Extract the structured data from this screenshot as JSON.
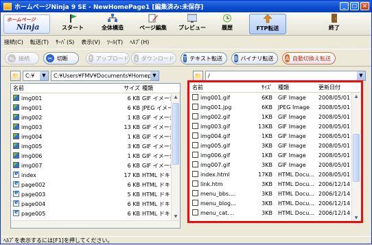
{
  "window": {
    "title": "ホームページNinja 9 SE - NewHomePage1 [編集済み:未保存]",
    "controls": [
      "_",
      "□",
      "×"
    ]
  },
  "toolbar": {
    "logo_top": "ホームページ",
    "logo_main": "Ninja",
    "tools": [
      {
        "label": "スタート",
        "icon": "start-flag-icon",
        "color": "#2ba34a"
      },
      {
        "label": "全体構造",
        "icon": "structure-icon",
        "color": "#3a68c8"
      },
      {
        "label": "ページ編集",
        "icon": "page-edit-icon",
        "color": "#d03a2a"
      },
      {
        "label": "プレビュー",
        "icon": "preview-icon",
        "color": "#555555"
      },
      {
        "label": "履歴",
        "icon": "history-icon",
        "color": "#6cb33a"
      },
      {
        "label": "FTP転送",
        "icon": "ftp-transfer-icon",
        "color": "#e08a1a"
      },
      {
        "label": "終了",
        "icon": "exit-door-icon",
        "color": "#8a5a2a"
      }
    ]
  },
  "menu": [
    "接続(C)",
    "転送(T)",
    "ｻｰﾊﾞ(S)",
    "表示(V)",
    "ﾂｰﾙ(T)",
    "ﾍﾙﾌﾟ(H)"
  ],
  "actions": {
    "connect": "接続",
    "disconnect": "切断",
    "upload": "アップロード",
    "download": "ダウンロード",
    "text_transfer": "テキスト転送",
    "binary_transfer": "バイナリ転送",
    "auto_transfer": "自動切換え転送"
  },
  "local": {
    "drive": "C:¥",
    "path": "C:¥Users¥FMV¥Documents¥Homepage Ninja¥w",
    "columns": [
      "名前",
      "サイズ",
      "種類"
    ],
    "files": [
      {
        "name": "img001",
        "size": "6 KB",
        "type": "GIF イメージ",
        "icon": "image"
      },
      {
        "name": "img001",
        "size": "6 KB",
        "type": "JPEG イメージ",
        "icon": "image"
      },
      {
        "name": "img002",
        "size": "1 KB",
        "type": "GIF イメージ",
        "icon": "image"
      },
      {
        "name": "img003",
        "size": "13 KB",
        "type": "GIF イメージ",
        "icon": "image"
      },
      {
        "name": "img004",
        "size": "1 KB",
        "type": "GIF イメージ",
        "icon": "image"
      },
      {
        "name": "img005",
        "size": "3 KB",
        "type": "GIF イメージ",
        "icon": "image"
      },
      {
        "name": "img006",
        "size": "1 KB",
        "type": "GIF イメージ",
        "icon": "image"
      },
      {
        "name": "img007",
        "size": "6 KB",
        "type": "GIF イメージ",
        "icon": "image"
      },
      {
        "name": "index",
        "size": "17 KB",
        "type": "HTML ドキュ",
        "icon": "html"
      },
      {
        "name": "page002",
        "size": "6 KB",
        "type": "HTML ドキュ",
        "icon": "html"
      },
      {
        "name": "page003",
        "size": "5 KB",
        "type": "HTML ドキュ",
        "icon": "html"
      },
      {
        "name": "page004",
        "size": "6 KB",
        "type": "HTML ドキュ",
        "icon": "html"
      },
      {
        "name": "page005",
        "size": "6 KB",
        "type": "HTML ドキュ",
        "icon": "html"
      }
    ]
  },
  "remote": {
    "path": "/",
    "columns": [
      "名前",
      "ｻｲｽﾞ",
      "種類",
      "更新日付"
    ],
    "files": [
      {
        "name": "img001.gif",
        "size": "6KB",
        "type": "GIF Image",
        "date": "2008/05/01"
      },
      {
        "name": "img001.jpg",
        "size": "6KB",
        "type": "JPEG Image",
        "date": "2008/05/01"
      },
      {
        "name": "img002.gif",
        "size": "1KB",
        "type": "GIF Image",
        "date": "2008/05/01"
      },
      {
        "name": "img003.gif",
        "size": "13KB",
        "type": "GIF Image",
        "date": "2008/05/01"
      },
      {
        "name": "img004.gif",
        "size": "1KB",
        "type": "GIF Image",
        "date": "2008/05/01"
      },
      {
        "name": "img005.gif",
        "size": "3KB",
        "type": "GIF Image",
        "date": "2008/05/01"
      },
      {
        "name": "img006.gif",
        "size": "1KB",
        "type": "GIF Image",
        "date": "2008/05/01"
      },
      {
        "name": "img007.gif",
        "size": "3KB",
        "type": "GIF Image",
        "date": "2008/05/01"
      },
      {
        "name": "index.html",
        "size": "17KB",
        "type": "HTML Docu...",
        "date": "2008/05/01"
      },
      {
        "name": "link.htm",
        "size": "3KB",
        "type": "HTML Docu...",
        "date": "2006/12/14"
      },
      {
        "name": "menu_bbs....",
        "size": "3KB",
        "type": "HTML Docu...",
        "date": "2006/12/14"
      },
      {
        "name": "menu_blog...",
        "size": "3KB",
        "type": "HTML Docu...",
        "date": "2006/12/14"
      },
      {
        "name": "menu_cat....",
        "size": "3KB",
        "type": "HTML Docu...",
        "date": "2006/12/14"
      }
    ]
  },
  "status": "ﾍﾙﾌﾟを表示するには[F1]を押してください。",
  "colors": {
    "highlight": "#ea0c10",
    "titlebar": "#0a4bd0"
  }
}
